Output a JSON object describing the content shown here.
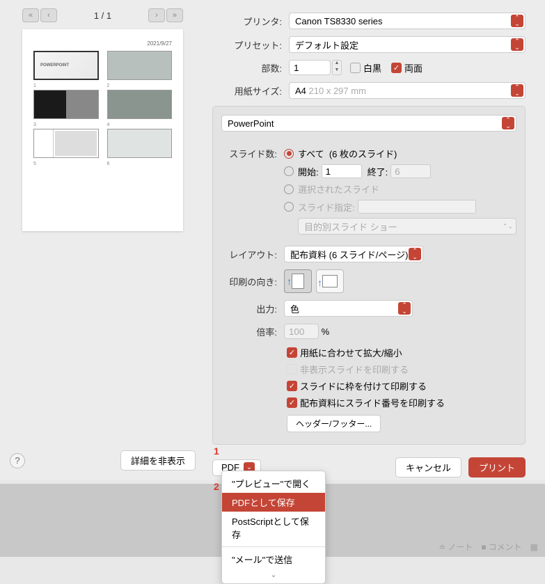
{
  "nav": {
    "page": "1 / 1"
  },
  "preview": {
    "date": "2021/9/27"
  },
  "labels": {
    "printer": "プリンタ:",
    "preset": "プリセット:",
    "copies": "部数:",
    "bw": "白黒",
    "duplex": "両面",
    "papersize": "用紙サイズ:",
    "slides": "スライド数:",
    "layout": "レイアウト:",
    "orientation": "印刷の向き:",
    "output": "出力:",
    "scale": "倍率:",
    "percent": "%"
  },
  "values": {
    "printer": "Canon TS8330 series",
    "preset": "デフォルト設定",
    "copies": "1",
    "papersize": "A4",
    "papersize_dim": "210 x 297 mm",
    "app": "PowerPoint",
    "layout": "配布資料 (6 スライド/ページ)",
    "output": "色",
    "scale": "100"
  },
  "slides": {
    "all": "すべて",
    "all_count": "(6 枚のスライド)",
    "from": "開始:",
    "from_val": "1",
    "to": "終了:",
    "to_val": "6",
    "selected": "選択されたスライド",
    "specify": "スライド指定:",
    "custom": "目的別スライド ショー"
  },
  "options": {
    "fit": "用紙に合わせて拡大/縮小",
    "hidden": "非表示スライドを印刷する",
    "frame": "スライドに枠を付けて印刷する",
    "number": "配布資料にスライド番号を印刷する",
    "headerfooter": "ヘッダー/フッター..."
  },
  "footer": {
    "details": "詳細を非表示",
    "pdf": "PDF",
    "cancel": "キャンセル",
    "print": "プリント"
  },
  "dropdown": {
    "preview": "\"プレビュー\"で開く",
    "save_pdf": "PDFとして保存",
    "save_ps": "PostScriptとして保存",
    "mail": "\"メール\"で送信"
  },
  "annotations": {
    "a1": "1",
    "a2": "2"
  },
  "status": {
    "notes": "ノート",
    "comments": "コメント"
  }
}
